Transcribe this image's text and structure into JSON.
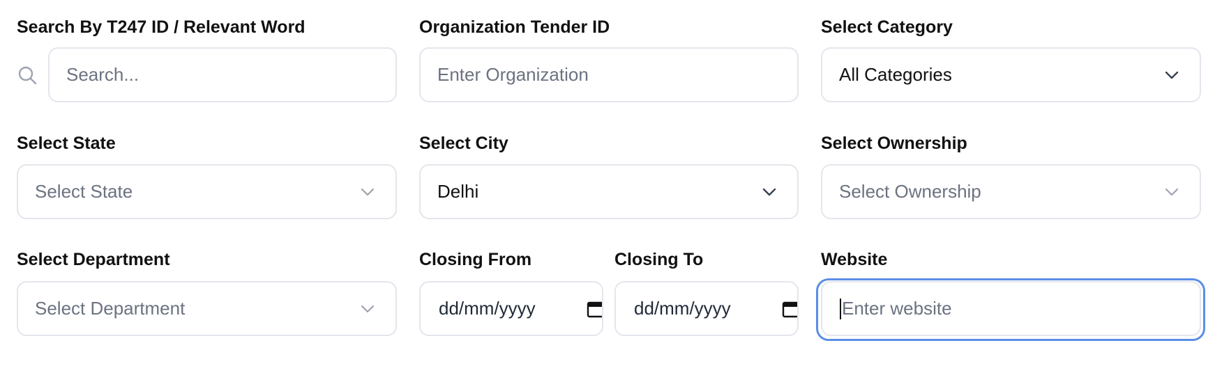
{
  "filters": {
    "search": {
      "label": "Search By T247 ID / Relevant Word",
      "placeholder": "Search...",
      "icon": "search-icon"
    },
    "org_tender": {
      "label": "Organization Tender ID",
      "placeholder": "Enter Organization"
    },
    "category": {
      "label": "Select Category",
      "value": "All Categories"
    },
    "state": {
      "label": "Select State",
      "placeholder": "Select State"
    },
    "city": {
      "label": "Select City",
      "value": "Delhi"
    },
    "ownership": {
      "label": "Select Ownership",
      "placeholder": "Select Ownership"
    },
    "department": {
      "label": "Select Department",
      "placeholder": "Select Department"
    },
    "closing_from": {
      "label": "Closing From",
      "value": "dd/mm/yyyy"
    },
    "closing_to": {
      "label": "Closing To",
      "value": "dd/mm/yyyy"
    },
    "website": {
      "label": "Website",
      "placeholder": "Enter website"
    }
  },
  "colors": {
    "border": "#e3e6ec",
    "placeholder": "#6b7280",
    "focus": "#5b8ee6"
  }
}
